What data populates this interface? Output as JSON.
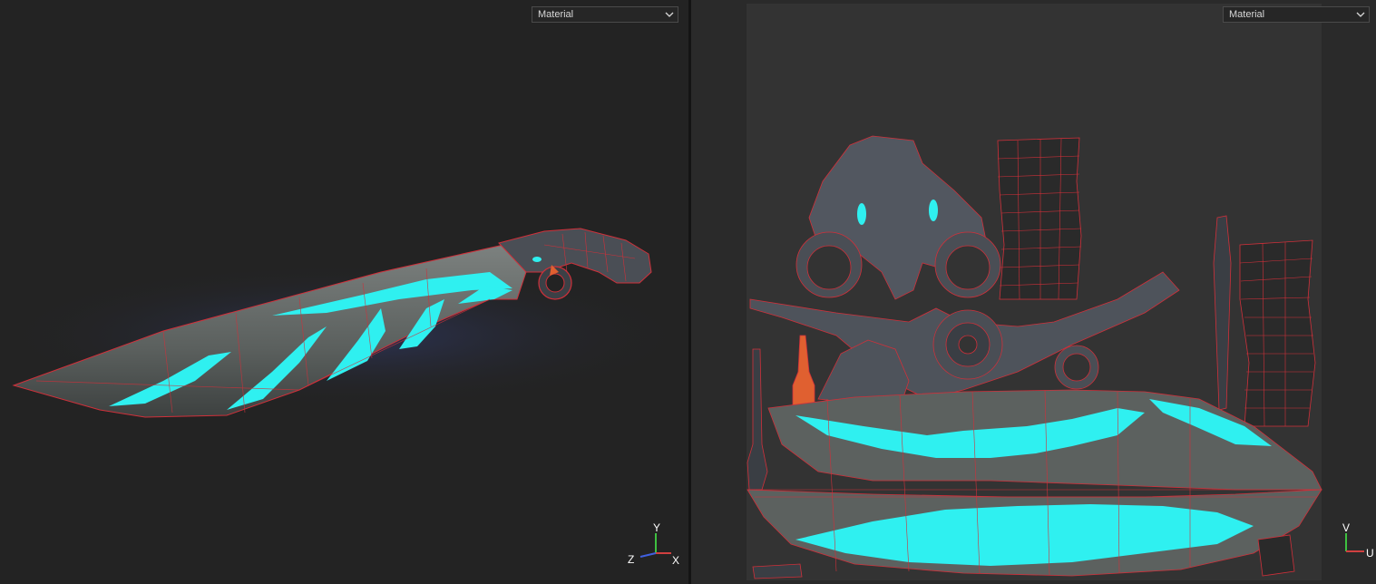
{
  "viewport_3d": {
    "shading_mode": "Material",
    "axis_gizmo": {
      "y": "Y",
      "z": "Z",
      "x": "X"
    }
  },
  "viewport_uv": {
    "shading_mode": "Material",
    "axis_gizmo": {
      "v": "V",
      "u": "U"
    }
  },
  "colors": {
    "wireframe": "#d0303a",
    "emissive": "#2ff0f0",
    "metal": "#5a6068",
    "background_3d": "#232323",
    "uv_canvas": "#333333",
    "marker": "#e06030"
  },
  "icons": [
    "chevron-down-icon",
    "axis-gizmo-3d-icon",
    "axis-gizmo-uv-icon"
  ]
}
